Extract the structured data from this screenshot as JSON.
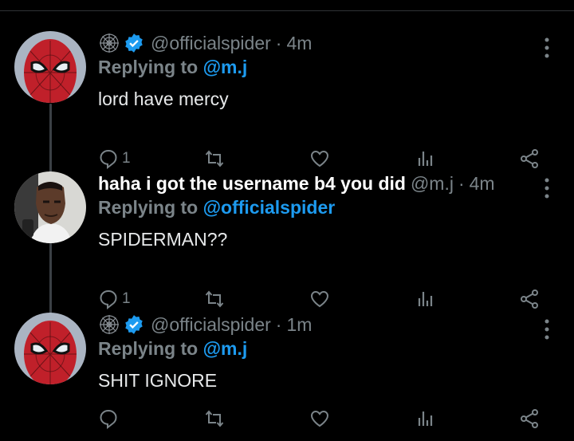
{
  "tweets": [
    {
      "name": "",
      "handle": "@officialspider",
      "time": "4m",
      "replying_prefix": "Replying to",
      "replying_to": "@m.j",
      "text": "lord have mercy",
      "reply_count": "1",
      "has_web_icon": true,
      "verified": true,
      "avatar": "spiderman-mask"
    },
    {
      "name": "haha i got the username b4 you did",
      "handle": "@m.j",
      "time": "4m",
      "replying_prefix": "Replying to",
      "replying_to": "@officialspider",
      "text": "SPIDERMAN??",
      "reply_count": "1",
      "has_web_icon": false,
      "verified": false,
      "avatar": "selfie-man"
    },
    {
      "name": "",
      "handle": "@officialspider",
      "time": "1m",
      "replying_prefix": "Replying to",
      "replying_to": "@m.j",
      "text": "SHIT IGNORE",
      "reply_count": "",
      "has_web_icon": true,
      "verified": true,
      "avatar": "spiderman-mask"
    }
  ],
  "icons": {
    "reply": "reply-icon",
    "retweet": "retweet-icon",
    "like": "heart-icon",
    "views": "analytics-icon",
    "share": "share-icon",
    "more": "more-vertical-icon"
  },
  "colors": {
    "background": "#000000",
    "accent": "#1d9bf0",
    "muted": "#7b8489",
    "text": "#e7e9ea"
  }
}
